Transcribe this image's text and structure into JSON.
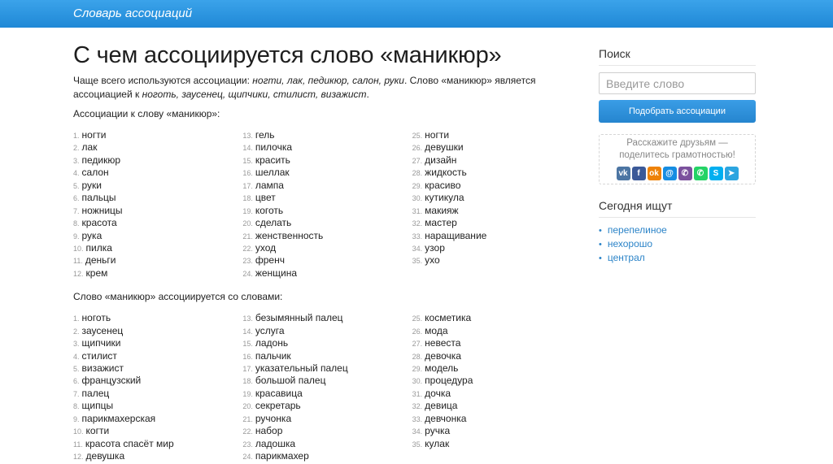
{
  "header": {
    "brand": "Словарь ассоциаций"
  },
  "main": {
    "title": "С чем ассоциируется слово «маникюр»",
    "intro_prefix": "Чаще всего используются ассоциации: ",
    "intro_top": "ногти, лак, педикюр, салон, руки",
    "intro_middle": ". Слово «маникюр» является ассоциацией к ",
    "intro_reverse": "ноготь, заусенец, щипчики, стилист, визажист",
    "intro_end": ".",
    "section1_title": "Ассоциации к слову «маникюр»:",
    "section1_cols": [
      [
        "ногти",
        "лак",
        "педикюр",
        "салон",
        "руки",
        "пальцы",
        "ножницы",
        "красота",
        "рука",
        "пилка",
        "деньги",
        "крем"
      ],
      [
        "гель",
        "пилочка",
        "красить",
        "шеллак",
        "лампа",
        "цвет",
        "коготь",
        "сделать",
        "женственность",
        "уход",
        "френч",
        "женщина"
      ],
      [
        "ногти",
        "девушки",
        "дизайн",
        "жидкость",
        "красиво",
        "кутикула",
        "макияж",
        "мастер",
        "наращивание",
        "узор",
        "ухо"
      ]
    ],
    "section2_title": "Слово «маникюр» ассоциируется со словами:",
    "section2_cols": [
      [
        "ноготь",
        "заусенец",
        "щипчики",
        "стилист",
        "визажист",
        "французский",
        "палец",
        "щипцы",
        "парикмахерская",
        "когти",
        "красота спасёт мир",
        "девушка"
      ],
      [
        "безымянный палец",
        "услуга",
        "ладонь",
        "пальчик",
        "указательный палец",
        "большой палец",
        "красавица",
        "секретарь",
        "ручонка",
        "набор",
        "ладошка",
        "парикмахер"
      ],
      [
        "косметика",
        "мода",
        "невеста",
        "девочка",
        "модель",
        "процедура",
        "дочка",
        "девица",
        "девчонка",
        "ручка",
        "кулак"
      ]
    ]
  },
  "sidebar": {
    "search_title": "Поиск",
    "search_placeholder": "Введите слово",
    "search_button": "Подобрать ассоциации",
    "share_line1": "Расскажите друзьям —",
    "share_line2": "поделитесь грамотностью!",
    "share_icons": [
      {
        "name": "vk-icon",
        "glyph": "vk",
        "color": "#4c75a3"
      },
      {
        "name": "facebook-icon",
        "glyph": "f",
        "color": "#3b5998"
      },
      {
        "name": "odnoklassniki-icon",
        "glyph": "ok",
        "color": "#ee8208"
      },
      {
        "name": "moimir-icon",
        "glyph": "@",
        "color": "#168de2"
      },
      {
        "name": "viber-icon",
        "glyph": "✆",
        "color": "#7b519d"
      },
      {
        "name": "whatsapp-icon",
        "glyph": "✆",
        "color": "#25d366"
      },
      {
        "name": "skype-icon",
        "glyph": "S",
        "color": "#00aff0"
      },
      {
        "name": "telegram-icon",
        "glyph": "➤",
        "color": "#2ca5e0"
      }
    ],
    "today_title": "Сегодня ищут",
    "today_items": [
      "перепелиное",
      "нехорошо",
      "централ"
    ]
  }
}
